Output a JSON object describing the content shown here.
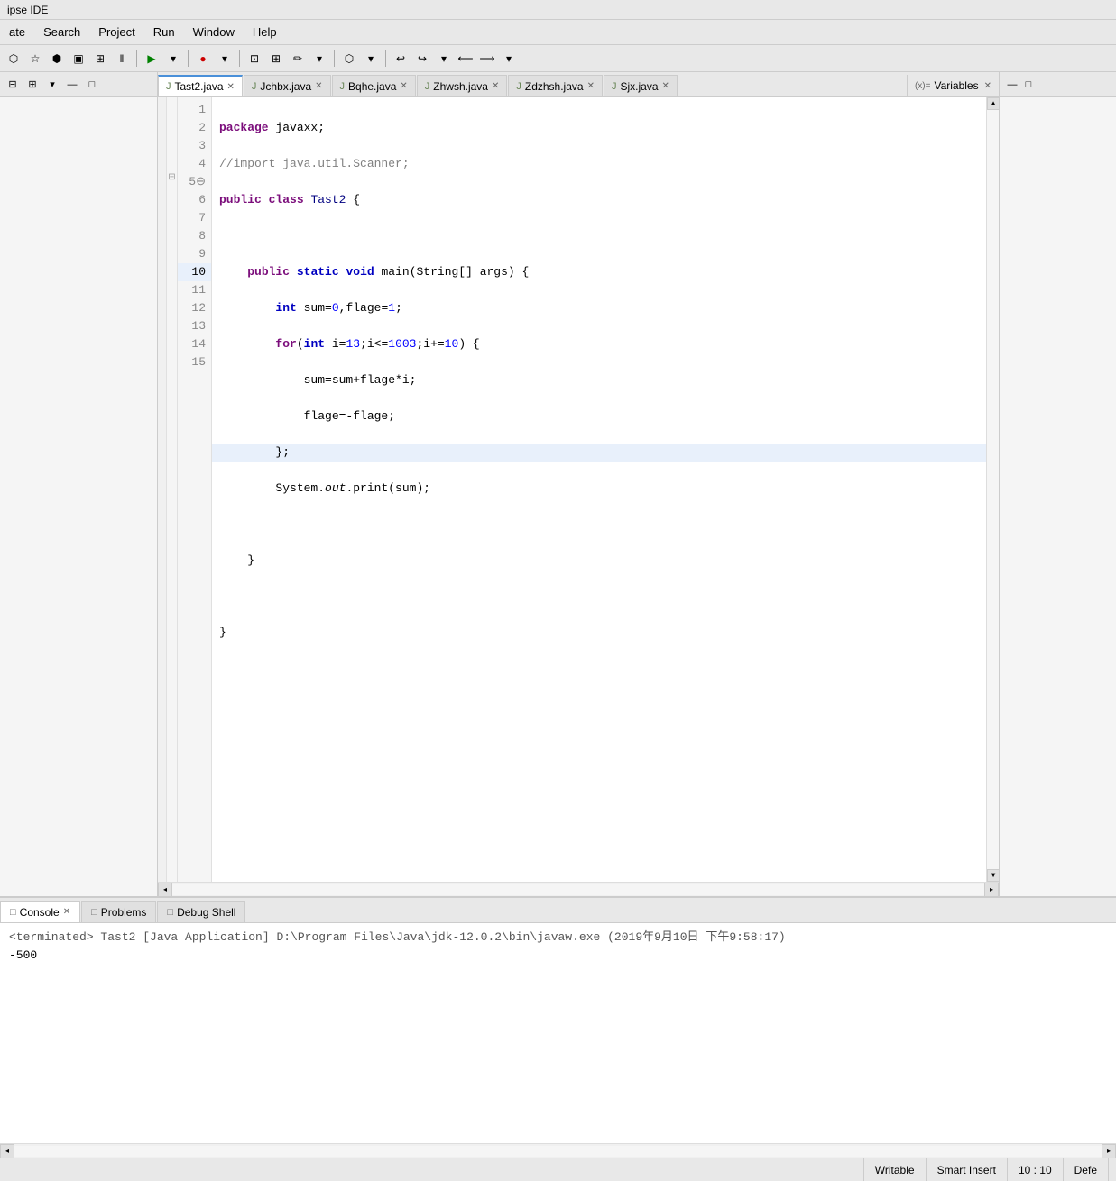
{
  "titlebar": {
    "text": "ipse IDE"
  },
  "menubar": {
    "items": [
      "ate",
      "Search",
      "Project",
      "Run",
      "Window",
      "Help"
    ]
  },
  "tabs": [
    {
      "label": "Tast2.java",
      "active": true,
      "icon": "J"
    },
    {
      "label": "Jchbx.java",
      "active": false,
      "icon": "J"
    },
    {
      "label": "Bqhe.java",
      "active": false,
      "icon": "J"
    },
    {
      "label": "Zhwsh.java",
      "active": false,
      "icon": "J"
    },
    {
      "label": "Zdzhsh.java",
      "active": false,
      "icon": "J"
    },
    {
      "label": "Sjx.java",
      "active": false,
      "icon": "J"
    }
  ],
  "variables_panel": {
    "label": "Variables"
  },
  "code": {
    "lines": [
      {
        "num": 1,
        "content": "package javaxx;",
        "active": false
      },
      {
        "num": 2,
        "content": "//import java.util.Scanner;",
        "active": false
      },
      {
        "num": 3,
        "content": "public class Tast2 {",
        "active": false
      },
      {
        "num": 4,
        "content": "",
        "active": false
      },
      {
        "num": 5,
        "content": "    public static void main(String[] args) {",
        "active": false,
        "fold": true
      },
      {
        "num": 6,
        "content": "        int sum=0,flage=1;",
        "active": false
      },
      {
        "num": 7,
        "content": "        for(int i=13;i<=1003;i+=10) {",
        "active": false
      },
      {
        "num": 8,
        "content": "            sum=sum+flage*i;",
        "active": false
      },
      {
        "num": 9,
        "content": "            flage=-flage;",
        "active": false
      },
      {
        "num": 10,
        "content": "        };",
        "active": true
      },
      {
        "num": 11,
        "content": "        System.out.print(sum);",
        "active": false
      },
      {
        "num": 12,
        "content": "",
        "active": false
      },
      {
        "num": 13,
        "content": "    }",
        "active": false
      },
      {
        "num": 14,
        "content": "",
        "active": false
      },
      {
        "num": 15,
        "content": "}",
        "active": false
      }
    ]
  },
  "console": {
    "tabs": [
      {
        "label": "Console",
        "active": true,
        "icon": "□"
      },
      {
        "label": "Problems",
        "active": false,
        "icon": "□"
      },
      {
        "label": "Debug Shell",
        "active": false,
        "icon": "□"
      }
    ],
    "terminated_text": "<terminated> Tast2 [Java Application] D:\\Program Files\\Java\\jdk-12.0.2\\bin\\javaw.exe (2019年9月10日 下午9:58:17)",
    "output": "-500"
  },
  "statusbar": {
    "writable": "Writable",
    "insert_mode": "Smart Insert",
    "position": "10 : 10",
    "right": "Defe"
  }
}
